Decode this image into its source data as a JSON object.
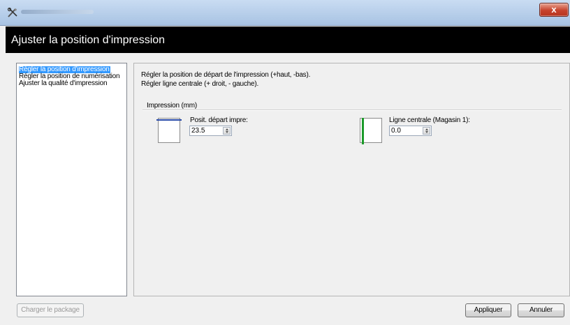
{
  "window": {
    "title": "",
    "close_label": "x"
  },
  "header": {
    "title": "Ajuster la position d'impression"
  },
  "nav": {
    "items": [
      {
        "label": "Régler la position d'impression",
        "selected": true
      },
      {
        "label": "Régler la position de numérisation",
        "selected": false
      },
      {
        "label": "Ajuster la qualité d'impression",
        "selected": false
      }
    ]
  },
  "panel": {
    "desc_line1": "Régler la position de départ de l'impression (+haut, -bas).",
    "desc_line2": "Régler ligne centrale (+ droit, - gauche).",
    "group_label": "Impression (mm)",
    "start_label": "Posit. départ impre:",
    "start_value": "23.5",
    "center_label": "Ligne centrale (Magasin 1):",
    "center_value": "0.0"
  },
  "footer": {
    "charger_label": "Charger le package",
    "apply_label": "Appliquer",
    "cancel_label": "Annuler"
  },
  "colors": {
    "header_bg": "#000000",
    "selection": "#3399ff",
    "top_margin_line": "#2749a8",
    "center_line": "#1c9a2a"
  }
}
